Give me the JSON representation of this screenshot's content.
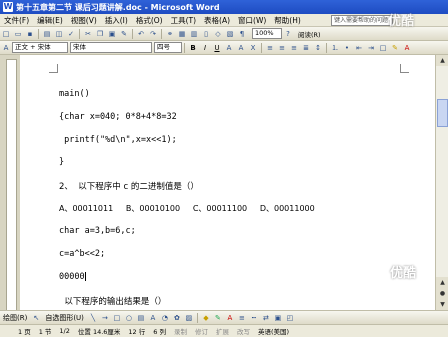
{
  "window": {
    "title": "第十五章第二节 课后习题讲解.doc - Microsoft Word",
    "app_icon": "W"
  },
  "menu": {
    "items": [
      "文件(F)",
      "编辑(E)",
      "视图(V)",
      "插入(I)",
      "格式(O)",
      "工具(T)",
      "表格(A)",
      "窗口(W)",
      "帮助(H)"
    ]
  },
  "help_box": {
    "placeholder": "键入需要帮助的问题"
  },
  "toolbar": {
    "zoom": "100%",
    "reading_label": "阅读(R)",
    "style": "正文 + 宋体",
    "font": "宋体",
    "size": "四号"
  },
  "document": {
    "lines": [
      "main()",
      "{char x=040; 0*8+4*8=32",
      " printf(\"%d\\n\",x=x<<1);",
      "}",
      "2、  以下程序中 c 的二进制值是（）",
      "A、00011011     B、00010100     C、00011100     D、00011000",
      "char a=3,b=6,c;",
      "c=a^b<<2;",
      "00000",
      "  以下程序的输出结果是（）"
    ]
  },
  "drawbar": {
    "draw_label": "绘图(R)",
    "autoshape_label": "自选图形(U)"
  },
  "status": {
    "page": "1 页",
    "section": "1 节",
    "pages": "1/2",
    "position": "位置 14.6厘米",
    "line": "12 行",
    "col": "6 列",
    "rec": "录制",
    "trk": "修订",
    "ext": "扩展",
    "ovr": "改写",
    "lang": "英语(美国)"
  },
  "watermark": {
    "text": "优酷"
  }
}
